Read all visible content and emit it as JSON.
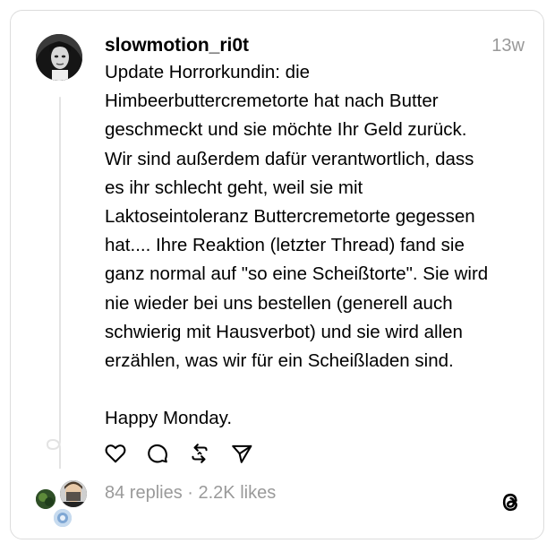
{
  "post": {
    "username": "slowmotion_ri0t",
    "timestamp": "13w",
    "lines": [
      "Update Horrorkundin: die",
      "Himbeerbuttercremetorte hat nach Butter",
      "geschmeckt und sie möchte Ihr Geld zurück.",
      "Wir sind außerdem dafür verantwortlich, dass",
      "es ihr schlecht geht, weil sie mit",
      "Laktoseintoleranz Buttercremetorte gegessen",
      "hat.... Ihre Reaktion (letzter Thread) fand sie",
      "ganz normal auf \"so eine Scheißtorte\". Sie wird",
      "nie wieder bei uns bestellen (generell auch",
      "schwierig mit Hausverbot) und sie wird allen",
      "erzählen, was wir für ein Scheißladen sind."
    ],
    "closing_line": "Happy Monday."
  },
  "actions": {
    "like_icon": "heart-icon",
    "reply_icon": "comment-icon",
    "repost_icon": "repost-icon",
    "share_icon": "send-icon"
  },
  "footer": {
    "stats": "84 replies · 2.2K likes",
    "logo_icon": "threads-logo-icon"
  },
  "colors": {
    "text": "#000000",
    "muted": "#999999",
    "border": "#dcdcdc",
    "thread_line": "#e3e3e3"
  }
}
